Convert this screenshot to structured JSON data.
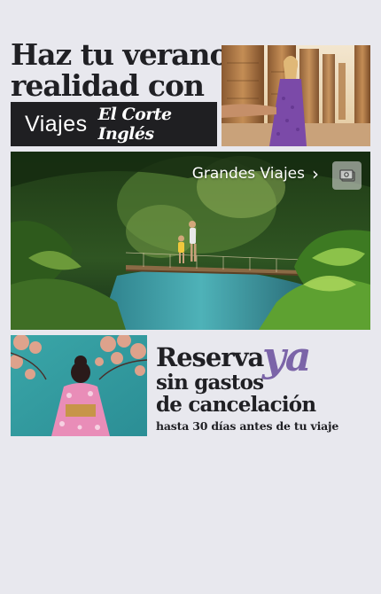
{
  "headline": {
    "line1": "Haz tu verano",
    "line2": "realidad con"
  },
  "brand": {
    "viajes": "Viajes",
    "store": "El Corte Inglés"
  },
  "banner": {
    "label": "Grandes Viajes",
    "arrow": "›",
    "camera_icon": "camera-icon"
  },
  "promo": {
    "line1": "Reserva",
    "ya": "ya",
    "line2": "sin gastos",
    "line3": "de cancelación",
    "line4": "hasta 30 días antes de tu viaje"
  },
  "colors": {
    "page_bg": "#e8e8ee",
    "brand_bar": "#1f1f22",
    "accent_purple": "#7b64a8",
    "text_dark": "#202024"
  }
}
